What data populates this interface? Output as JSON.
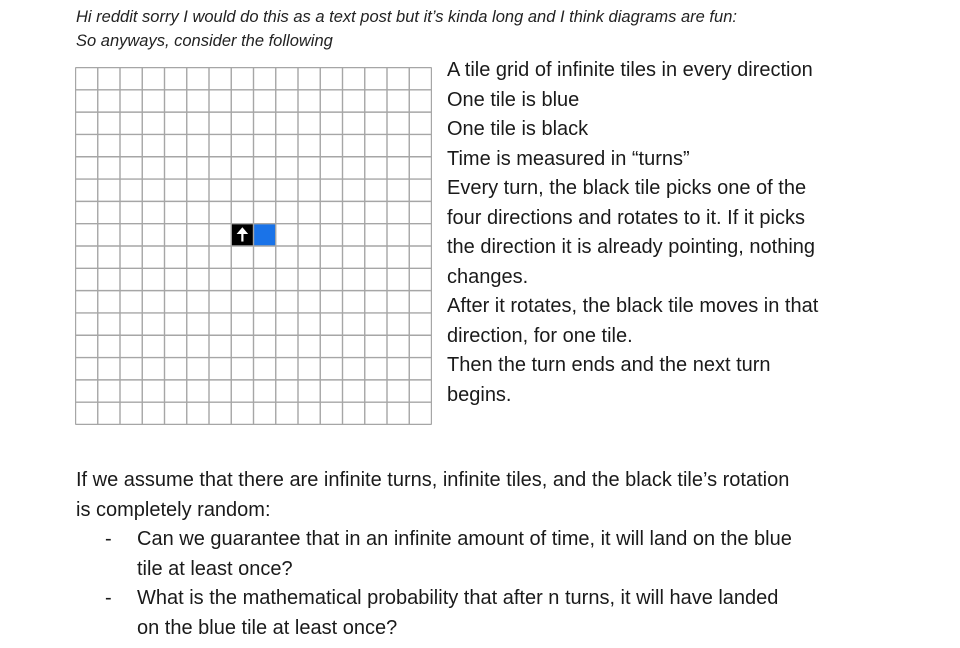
{
  "intro": {
    "line1": "Hi reddit sorry I would do this as a text post but it’s kinda long and I think diagrams are fun:",
    "line2": "So anyways, consider the following"
  },
  "grid": {
    "columns": 16,
    "rows": 16,
    "line_color": "#a6a6a6",
    "black_tile": {
      "col": 7,
      "row": 7,
      "color": "#000000",
      "direction": "up",
      "icon": "arrow-up-icon"
    },
    "blue_tile": {
      "col": 8,
      "row": 7,
      "color": "#1a73e8"
    }
  },
  "rules": [
    "A tile grid of infinite tiles in every direction",
    "One tile is blue",
    "One tile is black",
    "Time is measured in “turns”",
    "Every turn, the black tile picks one of the",
    "four directions and rotates to it. If it picks",
    "the direction it is already pointing, nothing",
    "changes.",
    "After it rotates, the black tile moves in that",
    "direction, for one tile.",
    "Then the turn ends and the next turn",
    "begins."
  ],
  "question_intro": {
    "line1": "If we assume that there are infinite turns, infinite tiles, and the black tile’s rotation",
    "line2": "is completely random:"
  },
  "questions": [
    {
      "bullet": "-",
      "lines": [
        "Can we guarantee that in an infinite amount of time, it will land on the blue",
        "tile at least once?"
      ]
    },
    {
      "bullet": "-",
      "lines": [
        "What is the mathematical probability that after n turns, it will have landed",
        "on the blue tile at least once?"
      ]
    }
  ]
}
